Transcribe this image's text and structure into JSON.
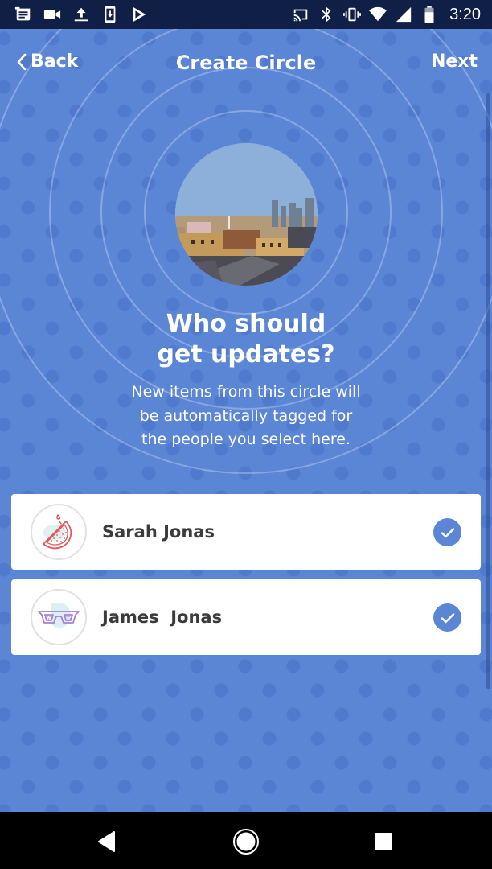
{
  "status_bar": {
    "left_icons": [
      "messages-icon",
      "video-camera-icon",
      "upload-icon",
      "download-to-device-icon",
      "play-store-icon"
    ],
    "right_icons": [
      "cast-icon",
      "bluetooth-icon",
      "vibrate-icon",
      "wifi-icon",
      "cell-signal-icon",
      "battery-icon"
    ],
    "time": "3:20"
  },
  "header": {
    "back_label": "Back",
    "title": "Create Circle",
    "next_label": "Next"
  },
  "circle_photo": {
    "description": "City skyline photo"
  },
  "prompt": {
    "heading_line1": "Who should",
    "heading_line2": "get updates?",
    "body_line1": "New items from this circle will",
    "body_line2": "be automatically tagged for",
    "body_line3": "the people you select here."
  },
  "people": [
    {
      "name": "Sarah Jonas",
      "avatar_icon": "watermelon-icon",
      "selected": true
    },
    {
      "name": "James  Jonas",
      "avatar_icon": "sunglasses-icon",
      "selected": true
    }
  ],
  "colors": {
    "background": "#5b86d6",
    "status_bar": "#0f1f45",
    "check_fill": "#5b86d6",
    "name_text": "#3b3b3b",
    "watermelon_stroke": "#e0585c",
    "sunglasses_stroke": "#a680d6"
  },
  "system_nav": {
    "back": "nav-back-icon",
    "home": "nav-home-icon",
    "recents": "nav-recents-icon"
  }
}
